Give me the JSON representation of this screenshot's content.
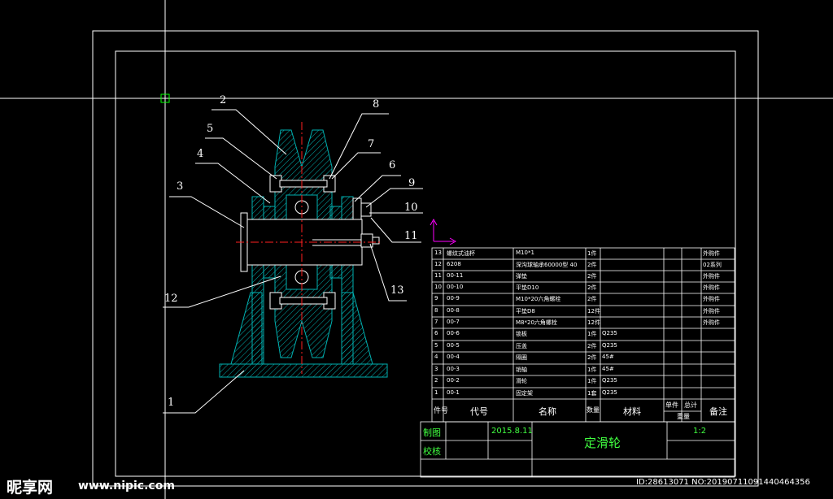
{
  "drawing": {
    "title": "定滑轮",
    "scale": "1:2",
    "date": "2015.8.11",
    "drawn_by_label": "制图",
    "checked_by_label": "校核"
  },
  "parts_header": {
    "no": "件号",
    "code": "代号",
    "name": "名称",
    "qty": "数量",
    "material": "材料",
    "unit_weight": "单件",
    "total": "总计",
    "weight": "重量",
    "remark": "备注"
  },
  "parts": [
    {
      "no": "13",
      "code": "螺纹式油杯",
      "name": "M10*1",
      "qty": "1件",
      "material": "",
      "remark": "外购件"
    },
    {
      "no": "12",
      "code": "6208",
      "name": "深沟球轴承60000型 40",
      "qty": "2件",
      "material": "",
      "remark": "02系列"
    },
    {
      "no": "11",
      "code": "00-11",
      "name": "弹垫",
      "qty": "2件",
      "material": "",
      "remark": "外购件"
    },
    {
      "no": "10",
      "code": "00-10",
      "name": "平垫D10",
      "qty": "2件",
      "material": "",
      "remark": "外购件"
    },
    {
      "no": "9",
      "code": "00-9",
      "name": "M10*20六角螺栓",
      "qty": "2件",
      "material": "",
      "remark": "外购件"
    },
    {
      "no": "8",
      "code": "00-8",
      "name": "平垫D8",
      "qty": "12件",
      "material": "",
      "remark": "外购件"
    },
    {
      "no": "7",
      "code": "00-7",
      "name": "M8*20六角螺栓",
      "qty": "12件",
      "material": "",
      "remark": "外购件"
    },
    {
      "no": "6",
      "code": "00-6",
      "name": "锁板",
      "qty": "1件",
      "material": "Q235",
      "remark": ""
    },
    {
      "no": "5",
      "code": "00-5",
      "name": "压盖",
      "qty": "2件",
      "material": "Q235",
      "remark": ""
    },
    {
      "no": "4",
      "code": "00-4",
      "name": "隔圈",
      "qty": "2件",
      "material": "45#",
      "remark": ""
    },
    {
      "no": "3",
      "code": "00-3",
      "name": "销轴",
      "qty": "1件",
      "material": "45#",
      "remark": ""
    },
    {
      "no": "2",
      "code": "00-2",
      "name": "滑轮",
      "qty": "1件",
      "material": "Q235",
      "remark": ""
    },
    {
      "no": "1",
      "code": "00-1",
      "name": "固定架",
      "qty": "1套",
      "material": "Q235",
      "remark": ""
    }
  ],
  "balloons": [
    "1",
    "2",
    "3",
    "4",
    "5",
    "6",
    "7",
    "8",
    "9",
    "10",
    "11",
    "12",
    "13"
  ],
  "watermark": {
    "logo": "昵享网",
    "site": "www.nipic.com",
    "id_text": "ID:28613071 NO:20190711091440464356"
  },
  "colors": {
    "line": "#ffffff",
    "part": "#00b0b0",
    "center": "#ff2020",
    "text_green": "#40ff40",
    "ucs_axis": "#ff00ff"
  }
}
